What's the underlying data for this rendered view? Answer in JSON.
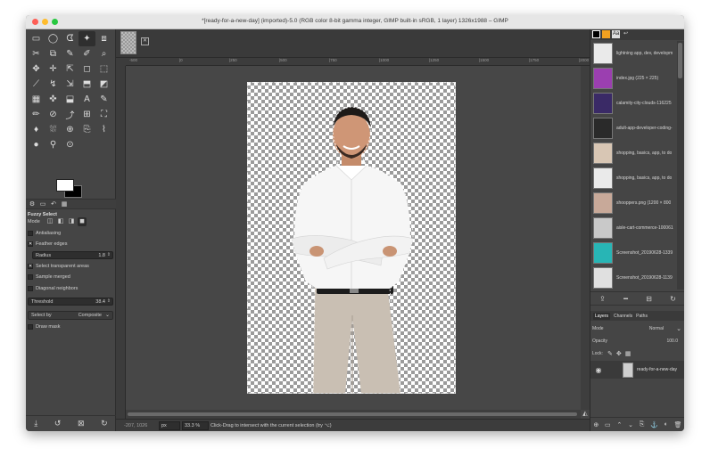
{
  "window": {
    "title": "*[ready-for-a-new-day] (imported)-5.0 (RGB color 8-bit gamma integer, GIMP built-in sRGB, 1 layer) 1326x1988 – GIMP"
  },
  "toolbox": {
    "tool_icons": [
      "▭",
      "◯",
      "ᗧ",
      "✦",
      "⧈",
      "✂",
      "⧉",
      "✎",
      "✐",
      "⌕",
      "✥",
      "✛",
      "⇱",
      "◻",
      "⬚",
      "⟋",
      "↯",
      "⇲",
      "⬒",
      "◩",
      "▦",
      "✜",
      "⬓",
      "A",
      "✎",
      "✏",
      "⊘",
      "⤴",
      "⊞",
      "⛶",
      "♦",
      "⛆",
      "⊕",
      "⎘",
      "⌇",
      "●",
      "⚲",
      "⊙",
      "",
      ""
    ],
    "fg_color": "#ffffff",
    "bg_color": "#000000",
    "options": {
      "tool_name": "Fuzzy Select",
      "mode_label": "Mode",
      "antialiasing": "Antialiasing",
      "feather_edges": "Feather edges",
      "radius_label": "Radius",
      "radius_value": "1.8",
      "select_transparent": "Select transparent areas",
      "sample_merged": "Sample merged",
      "diagonal_neighbors": "Diagonal neighbors",
      "threshold_label": "Threshold",
      "threshold_value": "38.4",
      "select_by_label": "Select by",
      "select_by_value": "Composite",
      "draw_mask": "Draw mask"
    }
  },
  "ruler": {
    "top_labels": [
      "-500",
      "|0",
      "|250",
      "|500",
      "|750",
      "|1000",
      "|1250",
      "|1500",
      "|1750",
      "|2000"
    ]
  },
  "status": {
    "coords": "-207, 1026",
    "unit": "px",
    "zoom": "33.3 %",
    "message": "Click-Drag to intersect with the current selection (try ⌥)"
  },
  "dock": {
    "documents": [
      {
        "name": "lightning app, dev, developm",
        "color": "#eaeaea"
      },
      {
        "name": "index.jpg (225 × 225)",
        "color": "#9b3fb0"
      },
      {
        "name": "calamity-city-clouds-116225",
        "color": "#3a2a66"
      },
      {
        "name": "adult-app-developer-coding-",
        "color": "#2a2a2a"
      },
      {
        "name": "shopping, basics, app, to do",
        "color": "#d8c6b4"
      },
      {
        "name": "shopping, basics, app, to do",
        "color": "#eaeaea"
      },
      {
        "name": "shooppers.png (1200 × 800",
        "color": "#c8a999"
      },
      {
        "name": "aisle-cart-commerce-100061",
        "color": "#c9c9c9"
      },
      {
        "name": "Screenshot_20190628-1339",
        "color": "#28b5b5"
      },
      {
        "name": "Screenshot_20190628-1139",
        "color": "#e0e0e0"
      }
    ],
    "tabs": {
      "layers": "Layers",
      "channels": "Channels",
      "paths": "Paths"
    },
    "mode_label": "Mode",
    "mode_value": "Normal",
    "opacity_label": "Opacity",
    "opacity_value": "100.0",
    "lock_label": "Lock:",
    "layer_name": "ready-for-a-new-day"
  }
}
